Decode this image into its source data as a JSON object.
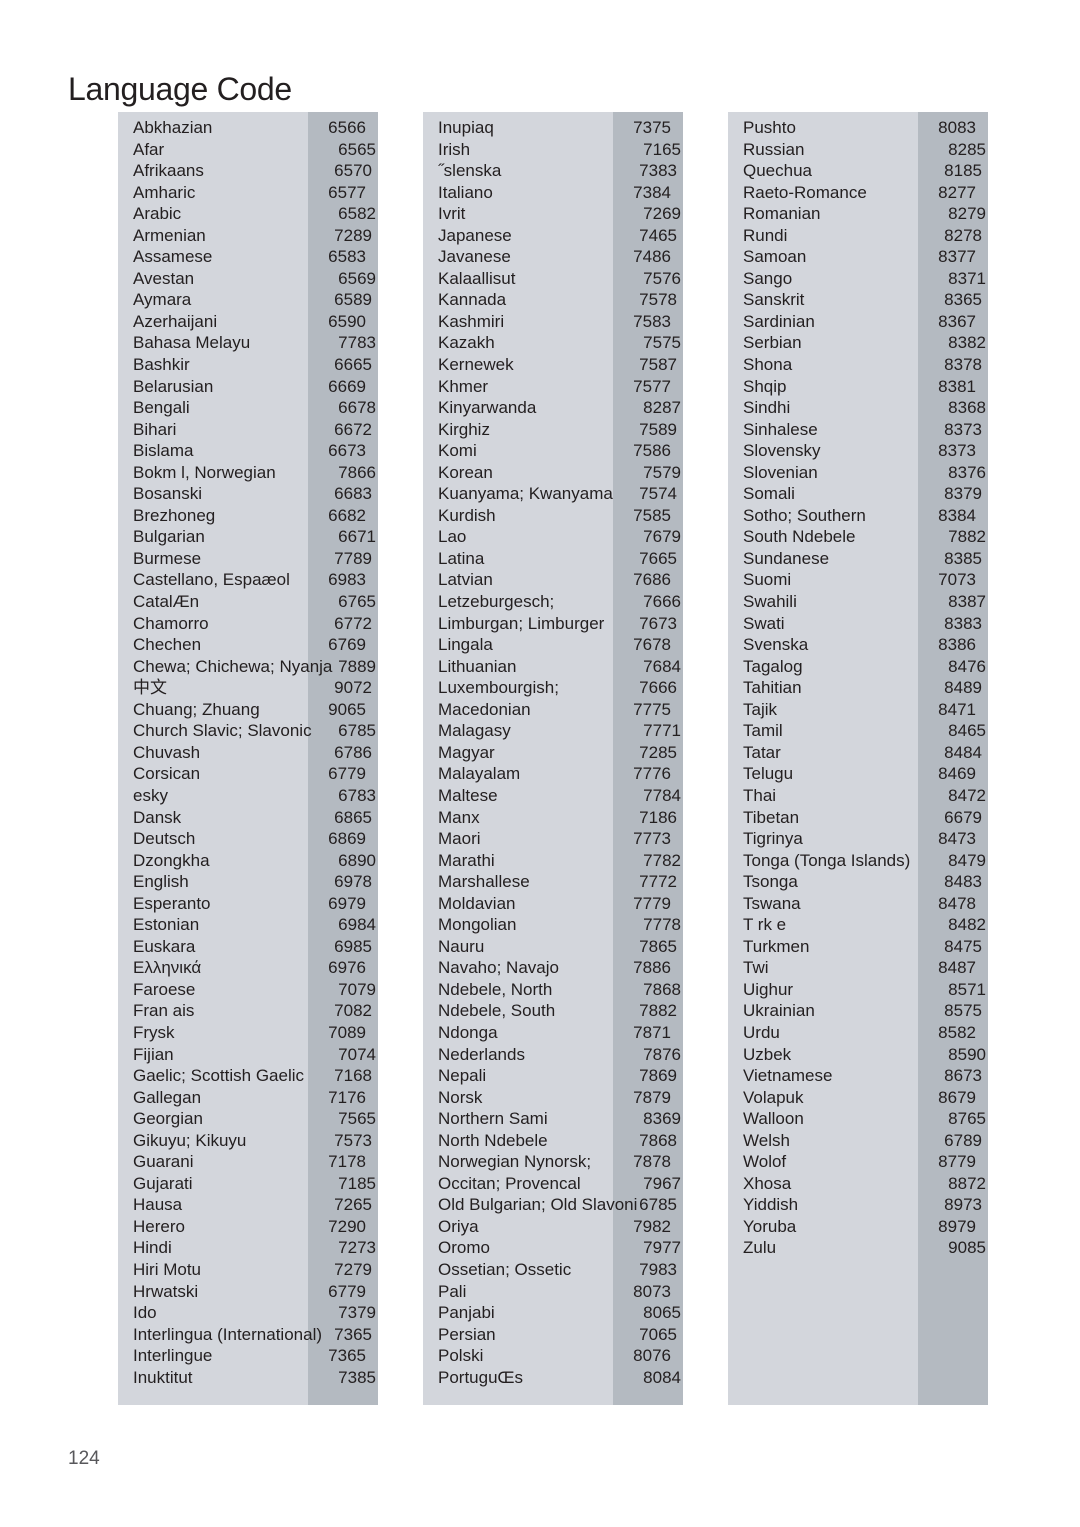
{
  "page": {
    "title": "Language Code",
    "number": "124",
    "colors": {
      "name_band": "#d3d6dc",
      "code_band": "#b4bac1",
      "text": "#231f20",
      "page_number": "#58585b",
      "background": "#ffffff"
    }
  },
  "columns": [
    {
      "id": "column-1",
      "rows": [
        {
          "name": "Abkhazian",
          "code": "6566"
        },
        {
          "name": "Afar",
          "code": "6565"
        },
        {
          "name": "Afrikaans",
          "code": "6570"
        },
        {
          "name": "Amharic",
          "code": "6577"
        },
        {
          "name": "Arabic",
          "code": "6582"
        },
        {
          "name": "Armenian",
          "code": "7289"
        },
        {
          "name": "Assamese",
          "code": "6583"
        },
        {
          "name": "Avestan",
          "code": "6569"
        },
        {
          "name": "Aymara",
          "code": "6589"
        },
        {
          "name": "Azerhaijani",
          "code": "6590"
        },
        {
          "name": "Bahasa Melayu",
          "code": "7783"
        },
        {
          "name": "Bashkir",
          "code": "6665"
        },
        {
          "name": "Belarusian",
          "code": "6669"
        },
        {
          "name": "Bengali",
          "code": "6678"
        },
        {
          "name": "Bihari",
          "code": "6672"
        },
        {
          "name": "Bislama",
          "code": "6673"
        },
        {
          "name": "Bokm l, Norwegian",
          "code": "7866"
        },
        {
          "name": "Bosanski",
          "code": "6683"
        },
        {
          "name": "Brezhoneg",
          "code": "6682"
        },
        {
          "name": "Bulgarian",
          "code": "6671"
        },
        {
          "name": "Burmese",
          "code": "7789"
        },
        {
          "name": "Castellano, Espaæol",
          "code": "6983"
        },
        {
          "name": "CatalÆn",
          "code": "6765"
        },
        {
          "name": "Chamorro",
          "code": "6772"
        },
        {
          "name": "Chechen",
          "code": "6769"
        },
        {
          "name": "Chewa; Chichewa; Nyanja",
          "code": "7889"
        },
        {
          "name": "中文",
          "code": "9072"
        },
        {
          "name": "Chuang; Zhuang",
          "code": "9065"
        },
        {
          "name": "Church Slavic; Slavonic",
          "code": "6785"
        },
        {
          "name": "Chuvash",
          "code": "6786"
        },
        {
          "name": "Corsican",
          "code": "6779"
        },
        {
          "name": " esky",
          "code": "6783"
        },
        {
          "name": "Dansk",
          "code": "6865"
        },
        {
          "name": "Deutsch",
          "code": "6869"
        },
        {
          "name": "Dzongkha",
          "code": "6890"
        },
        {
          "name": "English",
          "code": "6978"
        },
        {
          "name": "Esperanto",
          "code": "6979"
        },
        {
          "name": "Estonian",
          "code": "6984"
        },
        {
          "name": "Euskara",
          "code": "6985"
        },
        {
          "name": "Ελληνικά",
          "code": "6976"
        },
        {
          "name": "Faroese",
          "code": "7079"
        },
        {
          "name": "Fran ais",
          "code": "7082"
        },
        {
          "name": "Frysk",
          "code": "7089"
        },
        {
          "name": "Fijian",
          "code": "7074"
        },
        {
          "name": "Gaelic; Scottish Gaelic",
          "code": "7168"
        },
        {
          "name": "Gallegan",
          "code": "7176"
        },
        {
          "name": "Georgian",
          "code": "7565"
        },
        {
          "name": "Gikuyu; Kikuyu",
          "code": "7573"
        },
        {
          "name": "Guarani",
          "code": "7178"
        },
        {
          "name": "Gujarati",
          "code": "7185"
        },
        {
          "name": "Hausa",
          "code": "7265"
        },
        {
          "name": "Herero",
          "code": "7290"
        },
        {
          "name": "Hindi",
          "code": "7273"
        },
        {
          "name": "Hiri Motu",
          "code": "7279"
        },
        {
          "name": "Hrwatski",
          "code": "6779"
        },
        {
          "name": "Ido",
          "code": "7379"
        },
        {
          "name": "Interlingua (International)",
          "code": "7365"
        },
        {
          "name": "Interlingue",
          "code": "7365"
        },
        {
          "name": "Inuktitut",
          "code": "7385"
        }
      ]
    },
    {
      "id": "column-2",
      "rows": [
        {
          "name": "Inupiaq",
          "code": "7375"
        },
        {
          "name": "Irish",
          "code": "7165"
        },
        {
          "name": "˝slenska",
          "code": "7383"
        },
        {
          "name": "Italiano",
          "code": "7384"
        },
        {
          "name": "Ivrit",
          "code": "7269"
        },
        {
          "name": "Japanese",
          "code": "7465"
        },
        {
          "name": "Javanese",
          "code": "7486"
        },
        {
          "name": "Kalaallisut",
          "code": "7576"
        },
        {
          "name": "Kannada",
          "code": "7578"
        },
        {
          "name": "Kashmiri",
          "code": "7583"
        },
        {
          "name": "Kazakh",
          "code": "7575"
        },
        {
          "name": "Kernewek",
          "code": "7587"
        },
        {
          "name": "Khmer",
          "code": "7577"
        },
        {
          "name": "Kinyarwanda",
          "code": "8287"
        },
        {
          "name": "Kirghiz",
          "code": "7589"
        },
        {
          "name": "Komi",
          "code": "7586"
        },
        {
          "name": "Korean",
          "code": "7579"
        },
        {
          "name": "Kuanyama; Kwanyama",
          "code": "7574"
        },
        {
          "name": "Kurdish",
          "code": "7585"
        },
        {
          "name": "Lao",
          "code": "7679"
        },
        {
          "name": "Latina",
          "code": "7665"
        },
        {
          "name": "Latvian",
          "code": "7686"
        },
        {
          "name": "Letzeburgesch;",
          "code": "7666"
        },
        {
          "name": "Limburgan; Limburger",
          "code": "7673"
        },
        {
          "name": "Lingala",
          "code": "7678"
        },
        {
          "name": "Lithuanian",
          "code": "7684"
        },
        {
          "name": "Luxembourgish;",
          "code": "7666"
        },
        {
          "name": "Macedonian",
          "code": "7775"
        },
        {
          "name": "Malagasy",
          "code": "7771"
        },
        {
          "name": "Magyar",
          "code": "7285"
        },
        {
          "name": "Malayalam",
          "code": "7776"
        },
        {
          "name": "Maltese",
          "code": "7784"
        },
        {
          "name": "Manx",
          "code": "7186"
        },
        {
          "name": "Maori",
          "code": "7773"
        },
        {
          "name": "Marathi",
          "code": "7782"
        },
        {
          "name": "Marshallese",
          "code": "7772"
        },
        {
          "name": "Moldavian",
          "code": "7779"
        },
        {
          "name": "Mongolian",
          "code": "7778"
        },
        {
          "name": "Nauru",
          "code": "7865"
        },
        {
          "name": "Navaho; Navajo",
          "code": "7886"
        },
        {
          "name": "Ndebele, North",
          "code": "7868"
        },
        {
          "name": "Ndebele, South",
          "code": "7882"
        },
        {
          "name": "Ndonga",
          "code": "7871"
        },
        {
          "name": "Nederlands",
          "code": "7876"
        },
        {
          "name": "Nepali",
          "code": "7869"
        },
        {
          "name": "Norsk",
          "code": "7879"
        },
        {
          "name": "Northern Sami",
          "code": "8369"
        },
        {
          "name": "North Ndebele",
          "code": "7868"
        },
        {
          "name": "Norwegian Nynorsk;",
          "code": "7878"
        },
        {
          "name": "Occitan; Provencal",
          "code": "7967"
        },
        {
          "name": "Old Bulgarian; Old Slavoni",
          "code": "6785"
        },
        {
          "name": "Oriya",
          "code": "7982"
        },
        {
          "name": "Oromo",
          "code": "7977"
        },
        {
          "name": "Ossetian; Ossetic",
          "code": "7983"
        },
        {
          "name": "Pali",
          "code": "8073"
        },
        {
          "name": "Panjabi",
          "code": "8065"
        },
        {
          "name": "Persian",
          "code": "7065"
        },
        {
          "name": "Polski",
          "code": "8076"
        },
        {
          "name": "PortuguŒs",
          "code": "8084"
        }
      ]
    },
    {
      "id": "column-3",
      "rows": [
        {
          "name": "Pushto",
          "code": "8083"
        },
        {
          "name": "Russian",
          "code": "8285"
        },
        {
          "name": "Quechua",
          "code": "8185"
        },
        {
          "name": "Raeto-Romance",
          "code": "8277"
        },
        {
          "name": "Romanian",
          "code": "8279"
        },
        {
          "name": "Rundi",
          "code": "8278"
        },
        {
          "name": "Samoan",
          "code": "8377"
        },
        {
          "name": "Sango",
          "code": "8371"
        },
        {
          "name": "Sanskrit",
          "code": "8365"
        },
        {
          "name": "Sardinian",
          "code": "8367"
        },
        {
          "name": "Serbian",
          "code": "8382"
        },
        {
          "name": "Shona",
          "code": "8378"
        },
        {
          "name": "Shqip",
          "code": "8381"
        },
        {
          "name": "Sindhi",
          "code": "8368"
        },
        {
          "name": "Sinhalese",
          "code": "8373"
        },
        {
          "name": "Slovensky",
          "code": "8373"
        },
        {
          "name": "Slovenian",
          "code": "8376"
        },
        {
          "name": "Somali",
          "code": "8379"
        },
        {
          "name": "Sotho; Southern",
          "code": "8384"
        },
        {
          "name": "South Ndebele",
          "code": "7882"
        },
        {
          "name": "Sundanese",
          "code": "8385"
        },
        {
          "name": "Suomi",
          "code": "7073"
        },
        {
          "name": "Swahili",
          "code": "8387"
        },
        {
          "name": "Swati",
          "code": "8383"
        },
        {
          "name": "Svenska",
          "code": "8386"
        },
        {
          "name": "Tagalog",
          "code": "8476"
        },
        {
          "name": "Tahitian",
          "code": "8489"
        },
        {
          "name": "Tajik",
          "code": "8471"
        },
        {
          "name": "Tamil",
          "code": "8465"
        },
        {
          "name": "Tatar",
          "code": "8484"
        },
        {
          "name": "Telugu",
          "code": "8469"
        },
        {
          "name": "Thai",
          "code": "8472"
        },
        {
          "name": "Tibetan",
          "code": "6679"
        },
        {
          "name": "Tigrinya",
          "code": "8473"
        },
        {
          "name": "Tonga (Tonga Islands)",
          "code": "8479"
        },
        {
          "name": "Tsonga",
          "code": "8483"
        },
        {
          "name": "Tswana",
          "code": "8478"
        },
        {
          "name": "T rk e",
          "code": "8482"
        },
        {
          "name": "Turkmen",
          "code": "8475"
        },
        {
          "name": "Twi",
          "code": "8487"
        },
        {
          "name": "Uighur",
          "code": "8571"
        },
        {
          "name": "Ukrainian",
          "code": "8575"
        },
        {
          "name": "Urdu",
          "code": "8582"
        },
        {
          "name": "Uzbek",
          "code": "8590"
        },
        {
          "name": "Vietnamese",
          "code": "8673"
        },
        {
          "name": "Volapuk",
          "code": "8679"
        },
        {
          "name": "Walloon",
          "code": "8765"
        },
        {
          "name": "Welsh",
          "code": "6789"
        },
        {
          "name": "Wolof",
          "code": "8779"
        },
        {
          "name": "Xhosa",
          "code": "8872"
        },
        {
          "name": "Yiddish",
          "code": "8973"
        },
        {
          "name": "Yoruba",
          "code": "8979"
        },
        {
          "name": "Zulu",
          "code": "9085"
        }
      ]
    }
  ]
}
